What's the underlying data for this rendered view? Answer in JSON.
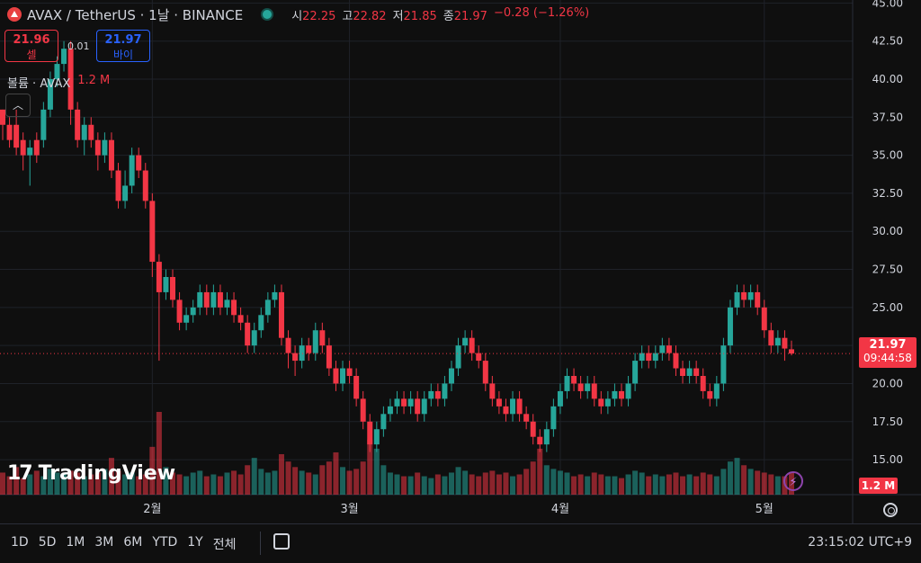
{
  "header": {
    "symbol": "AVAX / TetherUS · 1날 · BINANCE",
    "ohlc": [
      {
        "k": "시",
        "v": "22.25"
      },
      {
        "k": "고",
        "v": "22.82"
      },
      {
        "k": "저",
        "v": "21.85"
      },
      {
        "k": "종",
        "v": "21.97"
      }
    ],
    "change": "−0.28 (−1.26%)"
  },
  "trade": {
    "sell_price": "21.96",
    "sell_label": "셀",
    "spread": "0.01",
    "buy_price": "21.97",
    "buy_label": "바이"
  },
  "volume_legend": {
    "label": "볼륨 · AVAX",
    "value": "1.2 M"
  },
  "watermark": "TradingView",
  "last_price": {
    "price": "21.97",
    "countdown": "09:44:58"
  },
  "volume_last": "1.2 M",
  "bottom_bar": {
    "ranges": [
      "1D",
      "5D",
      "1M",
      "3M",
      "6M",
      "YTD",
      "1Y",
      "전체"
    ],
    "clock": "23:15:02 UTC+9"
  },
  "colors": {
    "up": "#26a69a",
    "down": "#f23645",
    "bg": "#0f0f0f",
    "grid": "#1f2229"
  },
  "chart_data": {
    "type": "candlestick",
    "y_ticks": [
      "45.00",
      "42.50",
      "40.00",
      "37.50",
      "35.00",
      "32.50",
      "30.00",
      "27.50",
      "25.00",
      "22.50",
      "20.00",
      "17.50",
      "15.00"
    ],
    "ylim": [
      12.7,
      45.2
    ],
    "x_ticks": [
      {
        "label": "2월",
        "index": 22
      },
      {
        "label": "3월",
        "index": 51
      },
      {
        "label": "4월",
        "index": 82
      },
      {
        "label": "5월",
        "index": 112
      }
    ],
    "candles": [
      [
        38,
        37,
        38,
        36
      ],
      [
        37,
        36,
        37.5,
        35.5
      ],
      [
        37,
        35.5,
        38,
        35
      ],
      [
        36,
        35,
        36.5,
        34
      ],
      [
        35,
        35.5,
        36,
        33
      ],
      [
        36,
        35,
        36.5,
        34.5
      ],
      [
        36,
        38,
        38.5,
        35.5
      ],
      [
        38,
        40,
        40.5,
        37.5
      ],
      [
        40,
        41,
        41.5,
        39.5
      ],
      [
        41,
        42,
        42.5,
        40.5
      ],
      [
        42,
        38,
        42.5,
        37
      ],
      [
        38,
        36,
        38.5,
        35.5
      ],
      [
        36,
        37,
        37.5,
        35
      ],
      [
        37,
        36,
        37.5,
        35.5
      ],
      [
        36,
        35,
        36.5,
        34
      ],
      [
        35,
        36,
        36.5,
        34.5
      ],
      [
        36,
        34,
        36.5,
        33.5
      ],
      [
        34,
        32,
        34.5,
        31.5
      ],
      [
        32,
        33,
        34,
        31.5
      ],
      [
        33,
        35,
        35.5,
        32.5
      ],
      [
        35,
        34,
        35.5,
        33.5
      ],
      [
        34,
        32,
        34.5,
        31.5
      ],
      [
        32,
        28,
        32.5,
        27
      ],
      [
        28,
        26,
        28.5,
        21.5
      ],
      [
        26,
        27,
        27.5,
        25.5
      ],
      [
        27,
        25.5,
        27.5,
        25
      ],
      [
        25.5,
        24,
        26,
        23.5
      ],
      [
        24,
        24.5,
        25,
        23.5
      ],
      [
        24.5,
        25,
        25.5,
        24
      ],
      [
        25,
        26,
        26.5,
        24.5
      ],
      [
        26,
        25,
        26.5,
        24.5
      ],
      [
        25,
        26,
        26.5,
        24.5
      ],
      [
        26,
        25,
        26.5,
        24.5
      ],
      [
        25,
        25.5,
        26,
        24.5
      ],
      [
        25.5,
        24.5,
        26,
        24
      ],
      [
        24.5,
        24,
        25,
        23.5
      ],
      [
        24,
        22.5,
        24.5,
        22
      ],
      [
        22.5,
        23.5,
        24,
        22
      ],
      [
        23.5,
        24.5,
        25,
        23
      ],
      [
        24.5,
        25.5,
        26,
        24
      ],
      [
        25.5,
        26,
        26.5,
        25
      ],
      [
        26,
        23,
        26.5,
        22.5
      ],
      [
        23,
        22,
        23.5,
        21
      ],
      [
        22,
        21.5,
        22.5,
        20.5
      ],
      [
        21.5,
        22.5,
        23,
        21
      ],
      [
        22.5,
        22,
        23,
        21.5
      ],
      [
        22,
        23.5,
        24,
        21.5
      ],
      [
        23.5,
        22.5,
        24,
        22
      ],
      [
        22.5,
        21,
        23,
        20.5
      ],
      [
        21,
        20,
        21.5,
        19.5
      ],
      [
        20,
        21,
        21.5,
        19.5
      ],
      [
        21,
        20.5,
        21.5,
        20
      ],
      [
        20.5,
        19,
        21,
        18.5
      ],
      [
        19,
        17.5,
        19.5,
        17
      ],
      [
        17.5,
        16,
        18,
        15.5
      ],
      [
        16,
        17,
        17.5,
        15.5
      ],
      [
        17,
        18,
        18.5,
        16.5
      ],
      [
        18,
        18.5,
        19,
        17.5
      ],
      [
        18.5,
        19,
        19.5,
        18
      ],
      [
        19,
        18.5,
        19.5,
        18
      ],
      [
        18.5,
        19,
        19.5,
        18
      ],
      [
        19,
        18,
        19.5,
        17.5
      ],
      [
        18,
        19,
        19.5,
        17.5
      ],
      [
        19,
        19.5,
        20,
        18.5
      ],
      [
        19.5,
        19,
        20,
        18.5
      ],
      [
        19,
        20,
        20.5,
        18.5
      ],
      [
        20,
        21,
        21.5,
        19.5
      ],
      [
        21,
        22.5,
        23,
        20.5
      ],
      [
        22.5,
        23,
        23.5,
        22
      ],
      [
        23,
        22,
        23.5,
        21.5
      ],
      [
        22,
        21.5,
        22.5,
        21
      ],
      [
        21.5,
        20,
        22,
        19.5
      ],
      [
        20,
        19,
        20.5,
        18.5
      ],
      [
        19,
        18.5,
        19.5,
        18
      ],
      [
        18.5,
        18,
        19,
        17.5
      ],
      [
        18,
        19,
        19.5,
        17.5
      ],
      [
        19,
        18,
        19.5,
        17.5
      ],
      [
        18,
        17.5,
        18.5,
        17
      ],
      [
        17.5,
        16.5,
        18,
        16
      ],
      [
        16.5,
        16,
        17,
        15.5
      ],
      [
        16,
        17,
        17.5,
        15.5
      ],
      [
        17,
        18.5,
        19,
        16.5
      ],
      [
        18.5,
        19.5,
        20,
        18
      ],
      [
        19.5,
        20.5,
        21,
        19
      ],
      [
        20.5,
        20,
        21,
        19.5
      ],
      [
        20,
        19.5,
        20.5,
        19
      ],
      [
        19.5,
        20,
        20.5,
        19
      ],
      [
        20,
        19,
        20.5,
        18.5
      ],
      [
        19,
        18.5,
        19.5,
        18
      ],
      [
        18.5,
        19,
        19.5,
        18
      ],
      [
        19,
        19.5,
        20,
        18.5
      ],
      [
        19.5,
        19,
        20,
        18.5
      ],
      [
        19,
        20,
        20.5,
        18.5
      ],
      [
        20,
        21.5,
        22,
        19.5
      ],
      [
        21.5,
        22,
        22.5,
        21
      ],
      [
        22,
        21.5,
        22.5,
        21
      ],
      [
        21.5,
        22,
        22.5,
        21
      ],
      [
        22,
        22.5,
        23,
        21.5
      ],
      [
        22.5,
        22,
        23,
        21.5
      ],
      [
        22,
        21,
        22.5,
        20.5
      ],
      [
        21,
        20.5,
        21.5,
        20
      ],
      [
        20.5,
        21,
        21.5,
        20
      ],
      [
        21,
        20.5,
        21.5,
        20
      ],
      [
        20.5,
        19.5,
        21,
        19
      ],
      [
        19.5,
        19,
        20,
        18.5
      ],
      [
        19,
        20,
        20.5,
        18.5
      ],
      [
        20,
        22.5,
        23,
        19.5
      ],
      [
        22.5,
        25,
        25.5,
        22
      ],
      [
        25,
        26,
        26.5,
        24.5
      ],
      [
        26,
        25.5,
        26.5,
        25
      ],
      [
        25.5,
        26,
        26.5,
        25
      ],
      [
        26,
        25,
        26.5,
        24.5
      ],
      [
        25,
        23.5,
        25.5,
        23
      ],
      [
        23.5,
        22.5,
        24,
        22
      ],
      [
        22.5,
        23,
        23.5,
        22
      ],
      [
        23,
        22.3,
        23.5,
        21.5
      ],
      [
        22.25,
        21.97,
        22.82,
        21.85
      ]
    ],
    "volumes": [
      1.2,
      1.0,
      1.5,
      0.9,
      1.1,
      1.3,
      1.0,
      1.4,
      1.2,
      1.1,
      1.3,
      1.2,
      1.0,
      1.1,
      1.2,
      1.4,
      2.0,
      1.3,
      1.1,
      1.2,
      1.0,
      1.1,
      2.6,
      4.5,
      1.5,
      1.2,
      1.1,
      1.0,
      1.2,
      1.3,
      1.0,
      1.1,
      1.0,
      1.2,
      1.3,
      1.1,
      1.6,
      2.0,
      1.4,
      1.2,
      1.3,
      2.2,
      1.8,
      1.5,
      1.3,
      1.2,
      1.1,
      1.6,
      1.8,
      2.3,
      1.5,
      1.3,
      1.4,
      1.8,
      3.0,
      2.5,
      1.6,
      1.2,
      1.1,
      1.0,
      1.0,
      1.2,
      1.0,
      0.9,
      1.1,
      1.0,
      1.2,
      1.5,
      1.3,
      1.1,
      1.0,
      1.2,
      1.3,
      1.1,
      1.2,
      1.0,
      1.1,
      1.4,
      1.8,
      2.5,
      1.6,
      1.4,
      1.3,
      1.2,
      1.0,
      1.1,
      1.0,
      1.2,
      1.1,
      1.0,
      1.0,
      0.9,
      1.1,
      1.3,
      1.2,
      1.0,
      1.1,
      1.0,
      1.1,
      1.2,
      1.0,
      1.1,
      1.0,
      1.2,
      1.1,
      1.0,
      1.4,
      1.8,
      2.0,
      1.6,
      1.4,
      1.3,
      1.2,
      1.1,
      1.0,
      1.0,
      1.2
    ]
  }
}
